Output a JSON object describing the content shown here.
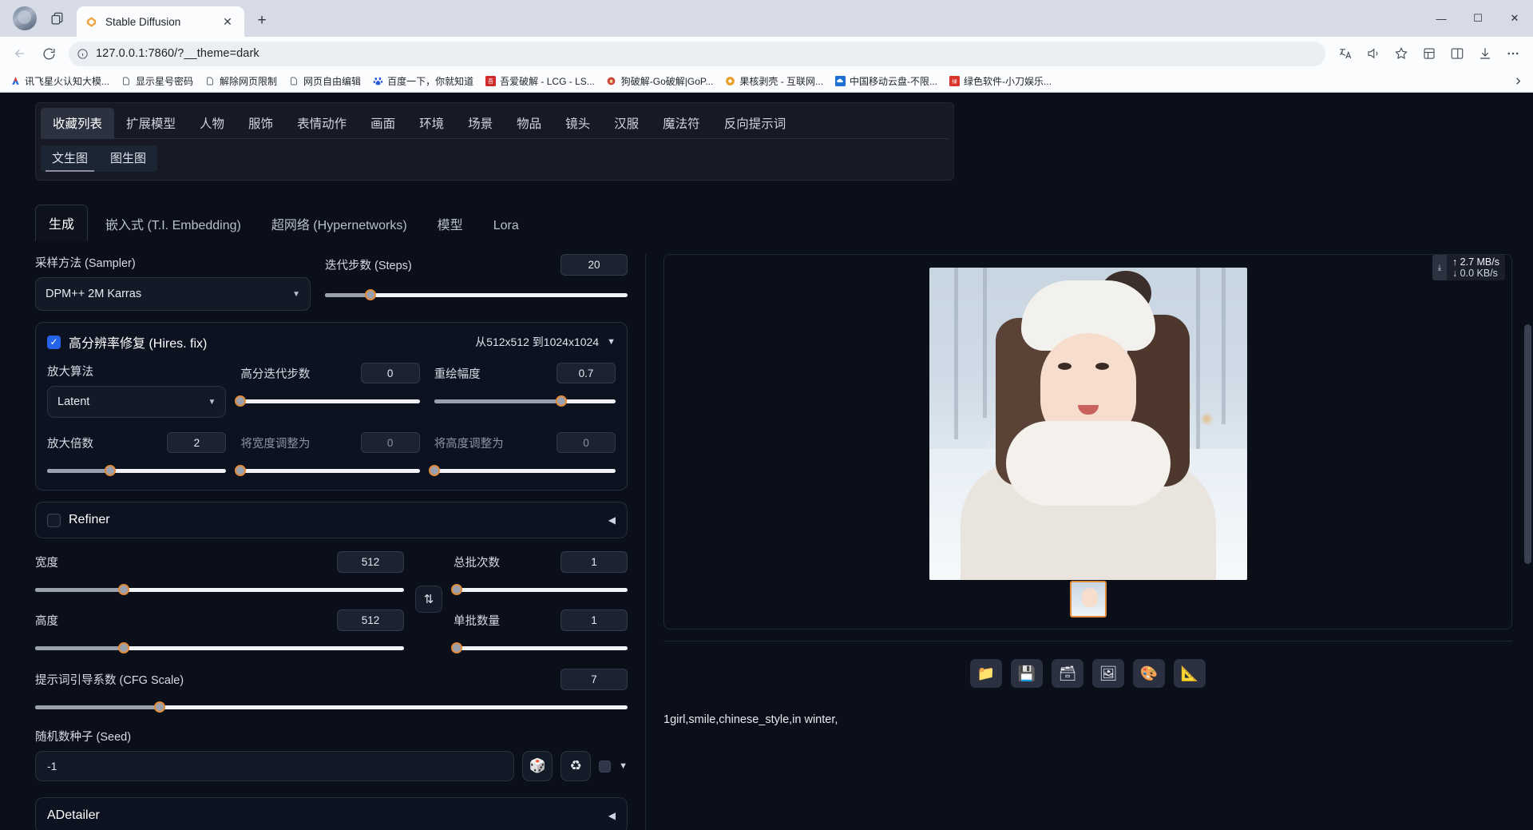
{
  "browser": {
    "tab": {
      "title": "Stable Diffusion",
      "favicon_icon": "stable-diffusion-favicon",
      "close_icon": "close-icon"
    },
    "new_tab_label": "+",
    "window_controls": {
      "minimize": "—",
      "maximize": "☐",
      "close": "✕"
    },
    "nav": {
      "back_icon": "back-arrow-icon",
      "reload_icon": "reload-icon",
      "info_icon": "site-info-icon",
      "url": "127.0.0.1:7860/?__theme=dark",
      "url_host": "127.0.0.1",
      "url_rest": ":7860/?__theme=dark",
      "translate_icon": "translate-icon",
      "read_aloud_icon": "read-aloud-icon",
      "favorite_icon": "star-icon",
      "collections_icon": "collections-icon",
      "split_screen_icon": "split-screen-icon",
      "downloads_icon": "downloads-icon",
      "settings_icon": "more-options-icon"
    },
    "bookmarks": [
      {
        "label": "讯飞星火认知大模...",
        "icon": "xinghuo-icon"
      },
      {
        "label": "显示星号密码",
        "icon": "page-icon"
      },
      {
        "label": "解除网页限制",
        "icon": "page-icon"
      },
      {
        "label": "网页自由编辑",
        "icon": "page-icon"
      },
      {
        "label": "百度一下，你就知道",
        "icon": "baidu-icon"
      },
      {
        "label": "吾爱破解 - LCG - LS...",
        "icon": "wuaipojie-icon"
      },
      {
        "label": "狗破解-Go破解|GoP...",
        "icon": "gopojie-icon"
      },
      {
        "label": "果核剥壳 - 互联网...",
        "icon": "guohe-icon"
      },
      {
        "label": "中国移动云盘-不限...",
        "icon": "cloud-icon"
      },
      {
        "label": "绿色软件-小刀娱乐...",
        "icon": "lvse-icon"
      }
    ],
    "bookmarks_overflow_icon": "chevron-right-icon"
  },
  "app": {
    "categories": [
      "收藏列表",
      "扩展模型",
      "人物",
      "服饰",
      "表情动作",
      "画面",
      "环境",
      "场景",
      "物品",
      "镜头",
      "汉服",
      "魔法符",
      "反向提示词"
    ],
    "active_category": "收藏列表",
    "subtabs": [
      "文生图",
      "图生图"
    ],
    "active_subtab": "文生图",
    "gen_tabs": [
      "生成",
      "嵌入式 (T.I. Embedding)",
      "超网络 (Hypernetworks)",
      "模型",
      "Lora"
    ],
    "active_gen_tab": "生成"
  },
  "form": {
    "sampler": {
      "label": "采样方法 (Sampler)",
      "value": "DPM++ 2M Karras",
      "caret_icon": "chevron-down-icon"
    },
    "steps": {
      "label": "迭代步数 (Steps)",
      "value": "20",
      "percent": 15
    },
    "hires": {
      "label": "高分辨率修复 (Hires. fix)",
      "enabled": true,
      "summary": "从512x512 到1024x1024",
      "collapse_icon": "chevron-down-icon",
      "upscaler": {
        "label": "放大算法",
        "value": "Latent",
        "caret_icon": "chevron-down-icon"
      },
      "hires_steps": {
        "label": "高分迭代步数",
        "value": "0",
        "percent": 0
      },
      "denoise": {
        "label": "重绘幅度",
        "value": "0.7",
        "percent": 70
      },
      "upscale_by": {
        "label": "放大倍数",
        "value": "2",
        "percent": 35
      },
      "resize_width": {
        "label": "将宽度调整为",
        "value": "0",
        "percent": 0
      },
      "resize_height": {
        "label": "将高度调整为",
        "value": "0",
        "percent": 0
      }
    },
    "refiner": {
      "label": "Refiner",
      "enabled": false,
      "collapse_icon": "chevron-left-icon"
    },
    "width": {
      "label": "宽度",
      "value": "512",
      "percent": 24
    },
    "height": {
      "label": "高度",
      "value": "512",
      "percent": 24
    },
    "swap_icon": "swap-dimensions-icon",
    "batch_count": {
      "label": "总批次数",
      "value": "1",
      "percent": 2
    },
    "batch_size": {
      "label": "单批数量",
      "value": "1",
      "percent": 2
    },
    "cfg": {
      "label": "提示词引导系数 (CFG Scale)",
      "value": "7",
      "percent": 21
    },
    "seed": {
      "label": "随机数种子 (Seed)",
      "value": "-1",
      "dice_icon": "dice-icon",
      "recycle_icon": "recycle-icon",
      "extra_checkbox_icon": "checkbox-icon",
      "expand_icon": "chevron-down-icon"
    },
    "adetailer": {
      "label": "ADetailer",
      "enabled": false,
      "collapse_icon": "chevron-left-icon"
    }
  },
  "output": {
    "network": {
      "download_icon": "download-icon",
      "up_icon": "↑",
      "up_speed": "2.7 MB/s",
      "down_icon": "↓",
      "down_speed": "0.0 KB/s"
    },
    "image_alt": "generated-preview",
    "thumbnail_alt": "gallery-thumbnail",
    "toolbar": [
      {
        "name": "open-folder-button",
        "icon": "📁"
      },
      {
        "name": "save-button",
        "icon": "💾"
      },
      {
        "name": "zip-button",
        "icon": "🗃"
      },
      {
        "name": "send-to-img2img-button",
        "icon": "🖼"
      },
      {
        "name": "send-to-inpaint-button",
        "icon": "🎨"
      },
      {
        "name": "send-to-extras-button",
        "icon": "📐"
      }
    ],
    "prompt": "1girl,smile,chinese_style,in winter,"
  }
}
